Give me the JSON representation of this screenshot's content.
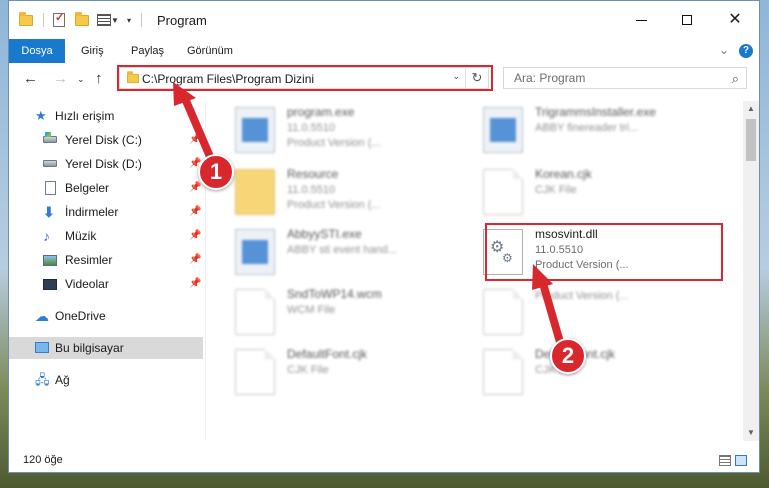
{
  "window": {
    "title": "Program",
    "controls": {
      "minimize": "—",
      "maximize": "☐",
      "close": "✕"
    }
  },
  "ribbon": {
    "tabs": [
      "Dosya",
      "Giriş",
      "Paylaş",
      "Görünüm"
    ],
    "help": "?"
  },
  "address_bar": {
    "path": "C:\\Program Files\\Program Dizini"
  },
  "search": {
    "placeholder": "Ara: Program"
  },
  "sidebar": {
    "quick_access": "Hızlı erişim",
    "items": [
      {
        "label": "Yerel Disk (C:)",
        "icon": "drive-c-icon",
        "pinned": true
      },
      {
        "label": "Yerel Disk (D:)",
        "icon": "drive-icon",
        "pinned": true
      },
      {
        "label": "Belgeler",
        "icon": "documents-icon",
        "pinned": true
      },
      {
        "label": "İndirmeler",
        "icon": "download-icon",
        "pinned": true
      },
      {
        "label": "Müzik",
        "icon": "music-icon",
        "pinned": true
      },
      {
        "label": "Resimler",
        "icon": "pictures-icon",
        "pinned": true
      },
      {
        "label": "Videolar",
        "icon": "videos-icon",
        "pinned": true
      }
    ],
    "onedrive": "OneDrive",
    "this_pc": "Bu bilgisayar",
    "network": "Ağ"
  },
  "files": [
    {
      "name": "program.exe",
      "line1": "11.0.5510",
      "line2": "Product Version    (...",
      "type": "exe"
    },
    {
      "name": "TrigrammsInstaller.exe",
      "line1": "ABBY finereader tri...",
      "line2": "",
      "type": "exe"
    },
    {
      "name": "Resource",
      "line1": "11.0.5510",
      "line2": "Product Version    (...",
      "type": "folder"
    },
    {
      "name": "Korean.cjk",
      "line1": "CJK File",
      "line2": "",
      "type": "page"
    },
    {
      "name": "AbbyySTI.exe",
      "line1": "ABBY sti event hand...",
      "line2": "",
      "type": "exe"
    },
    {
      "name": "msosvint.dll",
      "line1": "11.0.5510",
      "line2": "Product Version    (...",
      "type": "dll"
    },
    {
      "name": "SndToWP14.wcm",
      "line1": "WCM File",
      "line2": "",
      "type": "page"
    },
    {
      "name": "",
      "line1": "",
      "line2": "Product Version    (...",
      "type": "page"
    },
    {
      "name": "DefaultFont.cjk",
      "line1": "CJK File",
      "line2": "",
      "type": "page"
    },
    {
      "name": "DefaultFont.cjk",
      "line1": "CJK File",
      "line2": "",
      "type": "page"
    }
  ],
  "status": {
    "item_count": "120 öğe"
  },
  "annotations": {
    "step1": "1",
    "step2": "2",
    "color": "#d9272e"
  },
  "colors": {
    "accent": "#1979ca",
    "highlight": "#d9272e"
  }
}
